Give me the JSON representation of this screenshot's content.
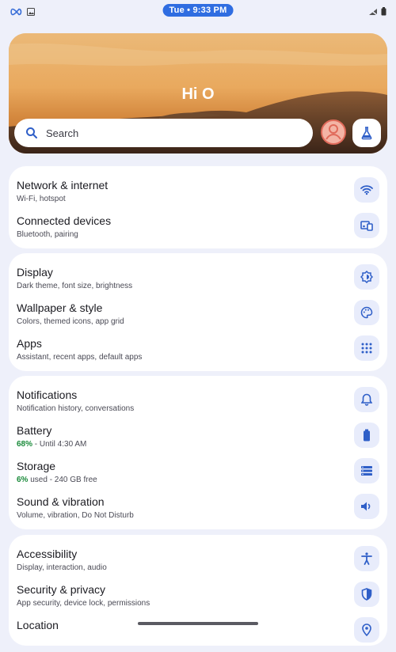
{
  "status_bar": {
    "time": "Tue • 9:33 PM"
  },
  "hero": {
    "greeting": "Hi O"
  },
  "search": {
    "placeholder": "Search"
  },
  "groups": [
    {
      "items": [
        {
          "title": "Network & internet",
          "subtitle": "Wi-Fi, hotspot",
          "icon": "wifi-icon"
        },
        {
          "title": "Connected devices",
          "subtitle": "Bluetooth, pairing",
          "icon": "devices-icon"
        }
      ]
    },
    {
      "items": [
        {
          "title": "Display",
          "subtitle": "Dark theme, font size, brightness",
          "icon": "brightness-icon"
        },
        {
          "title": "Wallpaper & style",
          "subtitle": "Colors, themed icons, app grid",
          "icon": "palette-icon"
        },
        {
          "title": "Apps",
          "subtitle": "Assistant, recent apps, default apps",
          "icon": "apps-grid-icon"
        }
      ]
    },
    {
      "items": [
        {
          "title": "Notifications",
          "subtitle": "Notification history, conversations",
          "icon": "bell-icon"
        },
        {
          "title": "Battery",
          "subtitle_highlight": "68%",
          "subtitle_rest": " - Until 4:30 AM",
          "icon": "battery-icon"
        },
        {
          "title": "Storage",
          "subtitle_highlight": "6%",
          "subtitle_rest": " used - 240 GB free",
          "icon": "storage-icon"
        },
        {
          "title": "Sound & vibration",
          "subtitle": "Volume, vibration, Do Not Disturb",
          "icon": "volume-icon"
        }
      ]
    },
    {
      "items": [
        {
          "title": "Accessibility",
          "subtitle": "Display, interaction, audio",
          "icon": "accessibility-icon"
        },
        {
          "title": "Security & privacy",
          "subtitle": "App security, device lock, permissions",
          "icon": "shield-icon"
        },
        {
          "title": "Location",
          "subtitle": "",
          "icon": "location-icon"
        }
      ]
    }
  ],
  "colors": {
    "accent": "#2f5fc8",
    "icon_bg": "#e8ecfb",
    "highlight": "#1a8a3a",
    "avatar": "#e06a5a"
  }
}
